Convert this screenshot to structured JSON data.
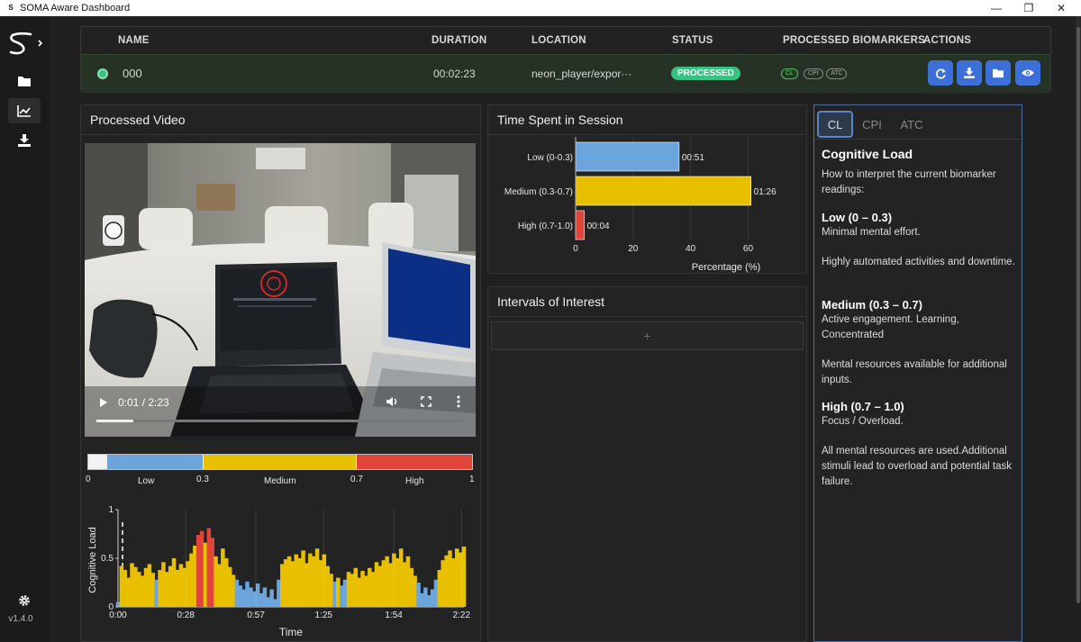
{
  "window": {
    "title": "SOMA Aware Dashboard",
    "minimize": "—",
    "maximize": "❐",
    "close": "✕"
  },
  "sidebar": {
    "version": "v1.4.0"
  },
  "table": {
    "headers": {
      "name": "NAME",
      "duration": "DURATION",
      "location": "LOCATION",
      "status": "STATUS",
      "biomarkers": "PROCESSED BIOMARKERS",
      "actions": "ACTIONS"
    },
    "row": {
      "name": "000",
      "duration": "00:02:23",
      "location": "neon_player/expor···",
      "status": "PROCESSED",
      "chips": [
        "CL",
        "CPI",
        "ATC"
      ]
    }
  },
  "video_panel": {
    "title": "Processed Video",
    "time": "0:01 / 2:23",
    "progress": 0.1
  },
  "scale": {
    "ticks": [
      "0",
      "0.3",
      "0.7",
      "1"
    ],
    "bands": [
      "Low",
      "Medium",
      "High"
    ]
  },
  "cl_chart": {
    "type": "area",
    "ylabel": "Cognitive Load",
    "xlabel": "Time",
    "y_ticks": [
      "0",
      "0.5",
      "1"
    ],
    "x_ticks": [
      "0:00",
      "0:28",
      "0:57",
      "1:25",
      "1:54",
      "2:22"
    ],
    "ylim": [
      0,
      1
    ],
    "duration_s": 143,
    "colors": {
      "low": "#6ba5dc",
      "medium": "#e8c000",
      "high": "#e0453a",
      "baseline": "#ffffff"
    },
    "values": [
      0.05,
      0.42,
      0.38,
      0.3,
      0.45,
      0.41,
      0.36,
      0.32,
      0.4,
      0.44,
      0.35,
      0.28,
      0.38,
      0.46,
      0.36,
      0.42,
      0.5,
      0.38,
      0.44,
      0.4,
      0.47,
      0.55,
      0.63,
      0.74,
      0.78,
      0.66,
      0.81,
      0.71,
      0.52,
      0.44,
      0.6,
      0.5,
      0.41,
      0.33,
      0.28,
      0.22,
      0.18,
      0.26,
      0.2,
      0.16,
      0.24,
      0.14,
      0.2,
      0.1,
      0.18,
      0.08,
      0.28,
      0.44,
      0.49,
      0.52,
      0.47,
      0.54,
      0.5,
      0.58,
      0.45,
      0.55,
      0.52,
      0.6,
      0.48,
      0.54,
      0.42,
      0.34,
      0.26,
      0.3,
      0.22,
      0.28,
      0.36,
      0.34,
      0.4,
      0.3,
      0.37,
      0.32,
      0.4,
      0.36,
      0.46,
      0.42,
      0.48,
      0.52,
      0.45,
      0.55,
      0.5,
      0.6,
      0.46,
      0.52,
      0.4,
      0.32,
      0.25,
      0.14,
      0.2,
      0.12,
      0.18,
      0.28,
      0.38,
      0.48,
      0.53,
      0.58,
      0.5,
      0.6,
      0.56,
      0.62
    ]
  },
  "time_spent": {
    "title": "Time Spent in Session",
    "chart_data": {
      "type": "bar",
      "orientation": "horizontal",
      "categories": [
        "Low (0-0.3)",
        "Medium (0.3-0.7)",
        "High (0.7-1.0)"
      ],
      "values": [
        36,
        61,
        3
      ],
      "data_labels": [
        "00:51",
        "01:26",
        "00:04"
      ],
      "colors": [
        "#6ba5dc",
        "#e8c000",
        "#e0453a"
      ],
      "x_ticks": [
        "0",
        "20",
        "40",
        "60"
      ],
      "xlim": [
        0,
        68
      ],
      "xlabel": "Percentage (%)"
    }
  },
  "intervals": {
    "title": "Intervals of Interest",
    "add_label": "+"
  },
  "info": {
    "tabs": [
      "CL",
      "CPI",
      "ATC"
    ],
    "heading": "Cognitive Load",
    "intro": "How to interpret the current biomarker readings:",
    "low_h": "Low (0 – 0.3)",
    "low_p1": "Minimal mental effort.",
    "low_p2": "Highly automated activities and downtime.",
    "med_h": "Medium (0.3 – 0.7)",
    "med_p1": "Active engagement. Learning, Concentrated",
    "med_p2": "Mental resources available for additional inputs.",
    "high_h": "High (0.7 – 1.0)",
    "high_p1": "Focus / Overload.",
    "high_p2": "All mental resources are used.Additional stimuli lead to overload and potential task failure."
  }
}
